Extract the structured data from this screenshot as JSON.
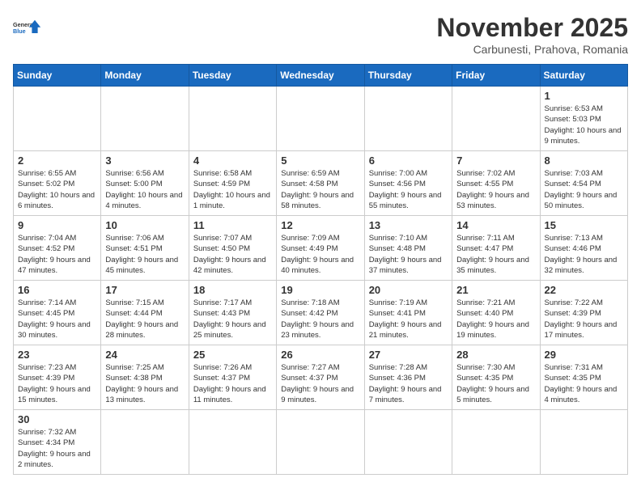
{
  "logo": {
    "text_general": "General",
    "text_blue": "Blue"
  },
  "calendar": {
    "title": "November 2025",
    "subtitle": "Carbunesti, Prahova, Romania",
    "headers": [
      "Sunday",
      "Monday",
      "Tuesday",
      "Wednesday",
      "Thursday",
      "Friday",
      "Saturday"
    ],
    "weeks": [
      [
        {
          "day": "",
          "info": ""
        },
        {
          "day": "",
          "info": ""
        },
        {
          "day": "",
          "info": ""
        },
        {
          "day": "",
          "info": ""
        },
        {
          "day": "",
          "info": ""
        },
        {
          "day": "",
          "info": ""
        },
        {
          "day": "1",
          "info": "Sunrise: 6:53 AM\nSunset: 5:03 PM\nDaylight: 10 hours and 9 minutes."
        }
      ],
      [
        {
          "day": "2",
          "info": "Sunrise: 6:55 AM\nSunset: 5:02 PM\nDaylight: 10 hours and 6 minutes."
        },
        {
          "day": "3",
          "info": "Sunrise: 6:56 AM\nSunset: 5:00 PM\nDaylight: 10 hours and 4 minutes."
        },
        {
          "day": "4",
          "info": "Sunrise: 6:58 AM\nSunset: 4:59 PM\nDaylight: 10 hours and 1 minute."
        },
        {
          "day": "5",
          "info": "Sunrise: 6:59 AM\nSunset: 4:58 PM\nDaylight: 9 hours and 58 minutes."
        },
        {
          "day": "6",
          "info": "Sunrise: 7:00 AM\nSunset: 4:56 PM\nDaylight: 9 hours and 55 minutes."
        },
        {
          "day": "7",
          "info": "Sunrise: 7:02 AM\nSunset: 4:55 PM\nDaylight: 9 hours and 53 minutes."
        },
        {
          "day": "8",
          "info": "Sunrise: 7:03 AM\nSunset: 4:54 PM\nDaylight: 9 hours and 50 minutes."
        }
      ],
      [
        {
          "day": "9",
          "info": "Sunrise: 7:04 AM\nSunset: 4:52 PM\nDaylight: 9 hours and 47 minutes."
        },
        {
          "day": "10",
          "info": "Sunrise: 7:06 AM\nSunset: 4:51 PM\nDaylight: 9 hours and 45 minutes."
        },
        {
          "day": "11",
          "info": "Sunrise: 7:07 AM\nSunset: 4:50 PM\nDaylight: 9 hours and 42 minutes."
        },
        {
          "day": "12",
          "info": "Sunrise: 7:09 AM\nSunset: 4:49 PM\nDaylight: 9 hours and 40 minutes."
        },
        {
          "day": "13",
          "info": "Sunrise: 7:10 AM\nSunset: 4:48 PM\nDaylight: 9 hours and 37 minutes."
        },
        {
          "day": "14",
          "info": "Sunrise: 7:11 AM\nSunset: 4:47 PM\nDaylight: 9 hours and 35 minutes."
        },
        {
          "day": "15",
          "info": "Sunrise: 7:13 AM\nSunset: 4:46 PM\nDaylight: 9 hours and 32 minutes."
        }
      ],
      [
        {
          "day": "16",
          "info": "Sunrise: 7:14 AM\nSunset: 4:45 PM\nDaylight: 9 hours and 30 minutes."
        },
        {
          "day": "17",
          "info": "Sunrise: 7:15 AM\nSunset: 4:44 PM\nDaylight: 9 hours and 28 minutes."
        },
        {
          "day": "18",
          "info": "Sunrise: 7:17 AM\nSunset: 4:43 PM\nDaylight: 9 hours and 25 minutes."
        },
        {
          "day": "19",
          "info": "Sunrise: 7:18 AM\nSunset: 4:42 PM\nDaylight: 9 hours and 23 minutes."
        },
        {
          "day": "20",
          "info": "Sunrise: 7:19 AM\nSunset: 4:41 PM\nDaylight: 9 hours and 21 minutes."
        },
        {
          "day": "21",
          "info": "Sunrise: 7:21 AM\nSunset: 4:40 PM\nDaylight: 9 hours and 19 minutes."
        },
        {
          "day": "22",
          "info": "Sunrise: 7:22 AM\nSunset: 4:39 PM\nDaylight: 9 hours and 17 minutes."
        }
      ],
      [
        {
          "day": "23",
          "info": "Sunrise: 7:23 AM\nSunset: 4:39 PM\nDaylight: 9 hours and 15 minutes."
        },
        {
          "day": "24",
          "info": "Sunrise: 7:25 AM\nSunset: 4:38 PM\nDaylight: 9 hours and 13 minutes."
        },
        {
          "day": "25",
          "info": "Sunrise: 7:26 AM\nSunset: 4:37 PM\nDaylight: 9 hours and 11 minutes."
        },
        {
          "day": "26",
          "info": "Sunrise: 7:27 AM\nSunset: 4:37 PM\nDaylight: 9 hours and 9 minutes."
        },
        {
          "day": "27",
          "info": "Sunrise: 7:28 AM\nSunset: 4:36 PM\nDaylight: 9 hours and 7 minutes."
        },
        {
          "day": "28",
          "info": "Sunrise: 7:30 AM\nSunset: 4:35 PM\nDaylight: 9 hours and 5 minutes."
        },
        {
          "day": "29",
          "info": "Sunrise: 7:31 AM\nSunset: 4:35 PM\nDaylight: 9 hours and 4 minutes."
        }
      ],
      [
        {
          "day": "30",
          "info": "Sunrise: 7:32 AM\nSunset: 4:34 PM\nDaylight: 9 hours and 2 minutes."
        },
        {
          "day": "",
          "info": ""
        },
        {
          "day": "",
          "info": ""
        },
        {
          "day": "",
          "info": ""
        },
        {
          "day": "",
          "info": ""
        },
        {
          "day": "",
          "info": ""
        },
        {
          "day": "",
          "info": ""
        }
      ]
    ]
  }
}
